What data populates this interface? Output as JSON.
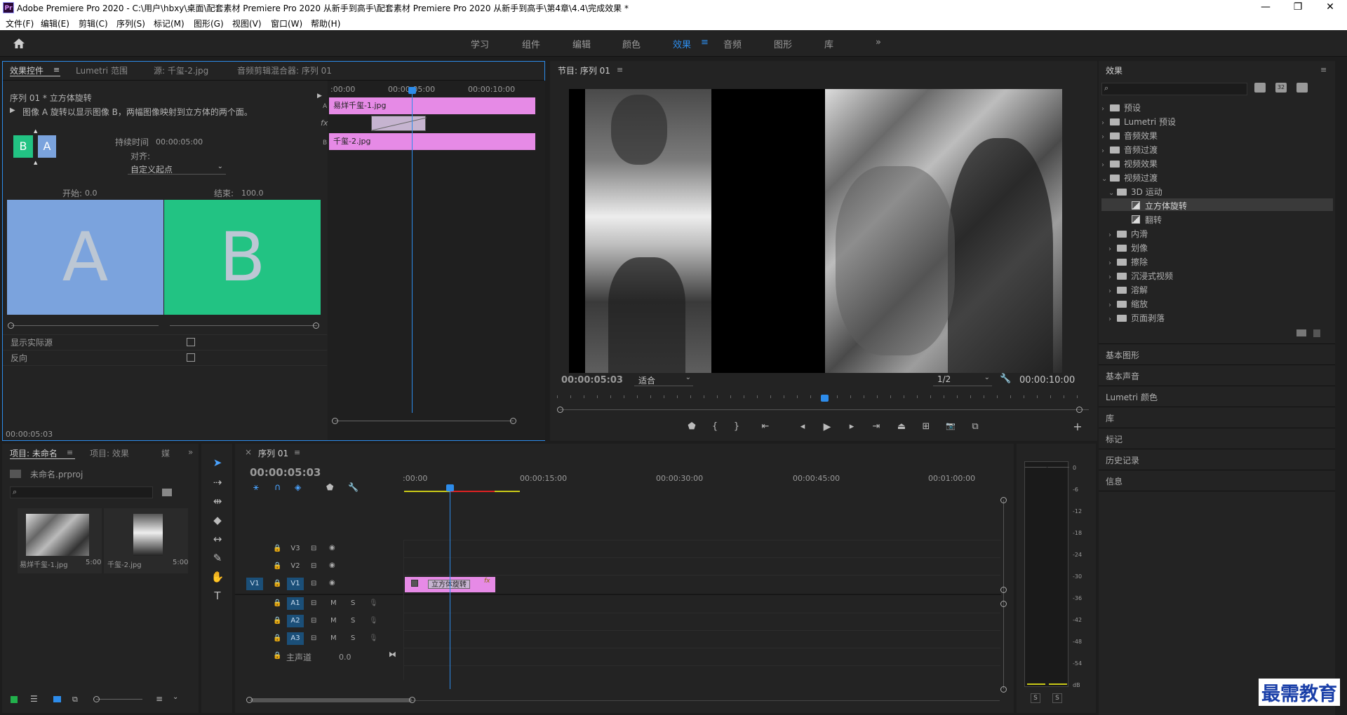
{
  "title_bar": {
    "app_icon": "Pr",
    "title": "Adobe Premiere Pro 2020 - C:\\用户\\hbxy\\桌面\\配套素材 Premiere Pro 2020 从新手到高手\\配套素材 Premiere Pro 2020 从新手到高手\\第4章\\4.4\\完成效果 *",
    "minimize": "—",
    "maximize": "❐",
    "close": "✕"
  },
  "menu": [
    "文件(F)",
    "编辑(E)",
    "剪辑(C)",
    "序列(S)",
    "标记(M)",
    "图形(G)",
    "视图(V)",
    "窗口(W)",
    "帮助(H)"
  ],
  "workspaces": {
    "items": [
      "学习",
      "组件",
      "编辑",
      "颜色",
      "效果",
      "音频",
      "图形",
      "库"
    ],
    "active": "效果",
    "more": "»",
    "home_icon": "home-icon"
  },
  "effect_controls": {
    "tabs": [
      "效果控件",
      "Lumetri 范围",
      "源: 千玺-2.jpg",
      "音频剪辑混合器: 序列 01"
    ],
    "sequence_label": "序列 01 * 立方体旋转",
    "description": "图像 A 旋转以显示图像 B，两幅图像映射到立方体的两个面。",
    "thumb_a": "A",
    "thumb_b": "B",
    "duration_label": "持续时间",
    "duration_value": "00:00:05:00",
    "align_label": "对齐:",
    "align_value": "自定义起点",
    "start_label": "开始:",
    "start_value": "0.0",
    "end_label": "结束:",
    "end_value": "100.0",
    "preview_a": "A",
    "preview_b": "B",
    "show_actual_sources": "显示实际源",
    "reverse": "反向",
    "timecode": "00:00:05:03",
    "mini_timeline": {
      "ticks": [
        ":00:00",
        "00:00:05:00",
        "00:00:10:00"
      ],
      "clip_a": "易烊千玺-1.jpg",
      "clip_b": "千玺-2.jpg",
      "track_a": "A",
      "track_b": "B",
      "fx": "fx"
    }
  },
  "program_monitor": {
    "title": "节目: 序列 01",
    "timecode": "00:00:05:03",
    "fit": "适合",
    "resolution": "1/2",
    "duration": "00:00:10:00",
    "controls": [
      "marker-icon",
      "mark-in-icon",
      "mark-out-icon",
      "go-to-in-icon",
      "step-back-icon",
      "play-icon",
      "step-forward-icon",
      "go-to-out-icon",
      "lift-icon",
      "extract-icon",
      "export-frame-icon",
      "compare-icon"
    ],
    "control_glyphs": [
      "⬟",
      "{",
      "}",
      "⇤",
      "◂|",
      "▶",
      "|▸",
      "⇥",
      "⏏",
      "⊞",
      "📷",
      "⧉"
    ],
    "add": "+"
  },
  "effects_panel": {
    "title": "效果",
    "tree": [
      {
        "label": "预设",
        "level": 0,
        "expanded": false
      },
      {
        "label": "Lumetri 预设",
        "level": 0,
        "expanded": false
      },
      {
        "label": "音频效果",
        "level": 0,
        "expanded": false
      },
      {
        "label": "音频过渡",
        "level": 0,
        "expanded": false
      },
      {
        "label": "视频效果",
        "level": 0,
        "expanded": false
      },
      {
        "label": "视频过渡",
        "level": 0,
        "expanded": true
      },
      {
        "label": "3D 运动",
        "level": 1,
        "expanded": true
      },
      {
        "label": "立方体旋转",
        "level": 2,
        "item": true,
        "selected": true
      },
      {
        "label": "翻转",
        "level": 2,
        "item": true
      },
      {
        "label": "内滑",
        "level": 1,
        "expanded": false
      },
      {
        "label": "划像",
        "level": 1,
        "expanded": false
      },
      {
        "label": "擦除",
        "level": 1,
        "expanded": false
      },
      {
        "label": "沉浸式视频",
        "level": 1,
        "expanded": false
      },
      {
        "label": "溶解",
        "level": 1,
        "expanded": false
      },
      {
        "label": "缩放",
        "level": 1,
        "expanded": false
      },
      {
        "label": "页面剥落",
        "level": 1,
        "expanded": false
      }
    ],
    "collapsed_panels": [
      "基本图形",
      "基本声音",
      "Lumetri 颜色",
      "库",
      "标记",
      "历史记录",
      "信息"
    ]
  },
  "project_panel": {
    "tabs": [
      "项目: 未命名",
      "项目: 效果",
      "媒"
    ],
    "project_file": "未命名.prproj",
    "items": [
      {
        "name": "易烊千玺-1.jpg",
        "duration": "5:00"
      },
      {
        "name": "千玺-2.jpg",
        "duration": "5:00"
      }
    ]
  },
  "timeline": {
    "tab": "序列 01",
    "timecode": "00:00:05:03",
    "ruler": [
      ":00:00",
      "00:00:15:00",
      "00:00:30:00",
      "00:00:45:00",
      "00:01:00:00"
    ],
    "video_tracks": [
      "V3",
      "V2",
      "V1"
    ],
    "source_v": "V1",
    "audio_tracks": [
      "A1",
      "A2",
      "A3"
    ],
    "master_label": "主声道",
    "master_value": "0.0",
    "mute": "M",
    "solo": "S",
    "transition_clip": "立方体旋转",
    "clip_fx": "fx"
  },
  "audio_meter": {
    "scale": [
      "0",
      "-6",
      "-12",
      "-18",
      "-24",
      "-30",
      "-36",
      "-42",
      "-48",
      "-54",
      "dB"
    ],
    "solo_left": "S",
    "solo_right": "S"
  },
  "watermark": "最需教育",
  "colors": {
    "accent": "#2d8ceb",
    "clip_pink": "#e68ae6",
    "transition_a": "#7ba3dd",
    "transition_b": "#22c383"
  }
}
